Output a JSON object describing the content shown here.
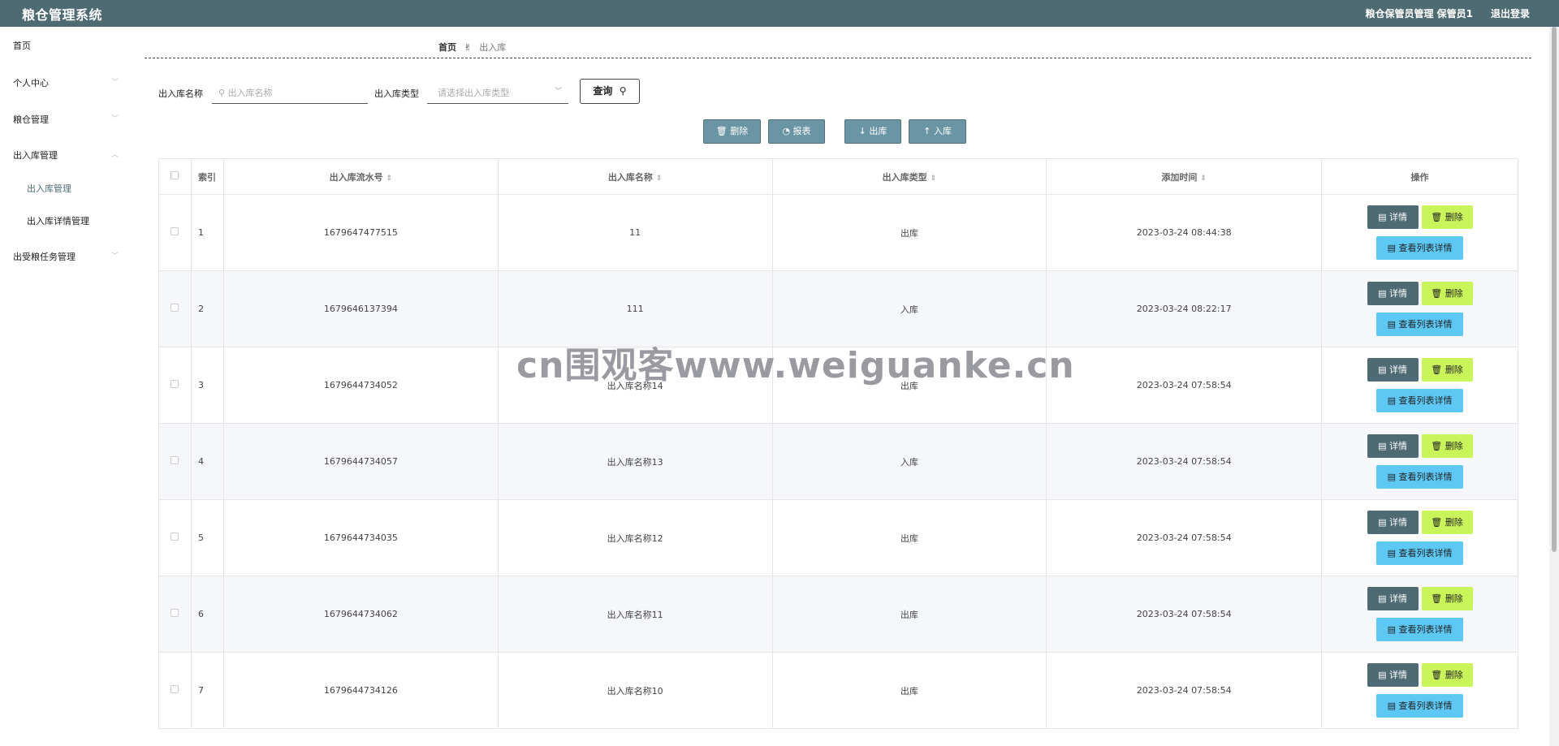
{
  "header": {
    "app_title": "粮仓管理系统",
    "user_info": "粮仓保管员管理 保管员1",
    "logout": "退出登录"
  },
  "sidebar": {
    "home": "首页",
    "personal": "个人中心",
    "granary": "粮仓管理",
    "inout": "出入库管理",
    "sub_inout": "出入库管理",
    "sub_inout_detail": "出入库详情管理",
    "task": "出受粮任务管理"
  },
  "breadcrumb": {
    "home": "首页",
    "current": "出入库"
  },
  "search": {
    "name_label": "出入库名称",
    "name_placeholder": "出入库名称",
    "type_label": "出入库类型",
    "type_placeholder": "请选择出入库类型",
    "query": "查询"
  },
  "toolbar": {
    "delete": "删除",
    "report": "报表",
    "out": "出库",
    "in": "入库"
  },
  "table": {
    "headers": {
      "index": "索引",
      "serial": "出入库流水号",
      "name": "出入库名称",
      "type": "出入库类型",
      "time": "添加时间",
      "ops": "操作"
    },
    "rows": [
      {
        "index": "1",
        "serial": "1679647477515",
        "name": "11",
        "type": "出库",
        "time": "2023-03-24 08:44:38"
      },
      {
        "index": "2",
        "serial": "1679646137394",
        "name": "111",
        "type": "入库",
        "time": "2023-03-24 08:22:17"
      },
      {
        "index": "3",
        "serial": "1679644734052",
        "name": "出入库名称14",
        "type": "出库",
        "time": "2023-03-24 07:58:54"
      },
      {
        "index": "4",
        "serial": "1679644734057",
        "name": "出入库名称13",
        "type": "入库",
        "time": "2023-03-24 07:58:54"
      },
      {
        "index": "5",
        "serial": "1679644734035",
        "name": "出入库名称12",
        "type": "出库",
        "time": "2023-03-24 07:58:54"
      },
      {
        "index": "6",
        "serial": "1679644734062",
        "name": "出入库名称11",
        "type": "出库",
        "time": "2023-03-24 07:58:54"
      },
      {
        "index": "7",
        "serial": "1679644734126",
        "name": "出入库名称10",
        "type": "出库",
        "time": "2023-03-24 07:58:54"
      }
    ],
    "op_detail": "详情",
    "op_delete": "删除",
    "op_list": "查看列表详情"
  },
  "watermark": "cn围观客www.weiguanke.cn",
  "colors": {
    "header_bg": "#4e6b74",
    "toolbar_btn": "#6a95a4",
    "op_delete": "#c9f55a",
    "op_list": "#5ec8f5"
  }
}
